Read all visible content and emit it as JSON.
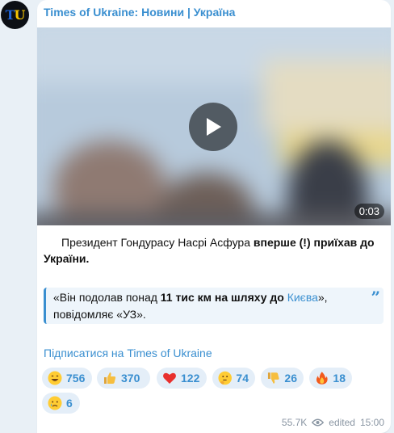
{
  "channel": {
    "avatar_text_t": "T",
    "avatar_text_u": "U",
    "title": "Times of Ukraine: Новини | Україна"
  },
  "video": {
    "duration": "0:03"
  },
  "caption": {
    "part1": "Президент Гондурасу Насрі Асфура ",
    "bold": "вперше (!) приїхав до України."
  },
  "quote": {
    "open": "«Він подолав понад ",
    "bold1": "11 тис км на шляху до ",
    "link": "Києва",
    "close": "», повідомляє «УЗ».",
    "mark": "”"
  },
  "subscribe_link": "Підписатися на Times of Ukraine",
  "reactions": [
    {
      "icon": "grinning-face-icon",
      "count": "756"
    },
    {
      "icon": "thumbs-up-icon",
      "count": "370"
    },
    {
      "icon": "red-heart-icon",
      "count": "122"
    },
    {
      "icon": "thinking-face-icon",
      "count": "74"
    },
    {
      "icon": "thumbs-down-icon",
      "count": "26"
    },
    {
      "icon": "fire-icon",
      "count": "18"
    },
    {
      "icon": "crying-face-icon",
      "count": "6"
    }
  ],
  "meta": {
    "views": "55.7K",
    "edited": "edited",
    "time": "15:00"
  },
  "colors": {
    "accent": "#3a8fd0",
    "background": "#e9f0f6",
    "reaction_bg": "#e4eef8"
  }
}
